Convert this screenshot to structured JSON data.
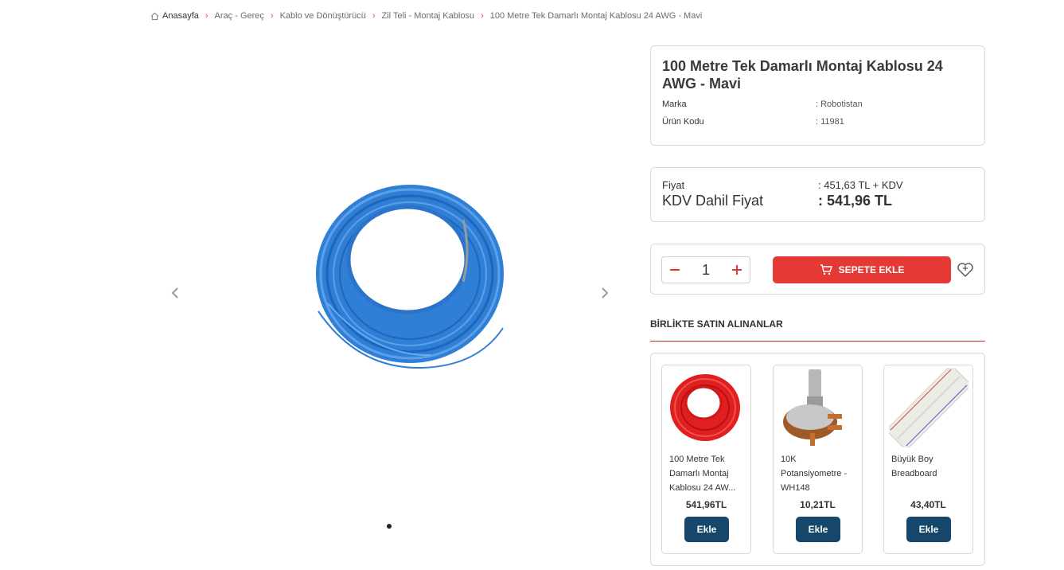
{
  "breadcrumb": {
    "items": [
      "Anasayfa",
      "Araç - Gereç",
      "Kablo ve Dönüştürücü",
      "Zil Teli - Montaj Kablosu",
      "100 Metre Tek Damarlı Montaj Kablosu 24 AWG - Mavi"
    ]
  },
  "product": {
    "title": "100 Metre Tek Damarlı Montaj Kablosu 24 AWG - Mavi",
    "brand_label": "Marka",
    "brand_value": ": Robotistan",
    "code_label": "Ürün Kodu",
    "code_value": ": 11981",
    "image_color": "#2f7fd6"
  },
  "pricing": {
    "price_label": "Fiyat",
    "price_value": ": 451,63 TL + KDV",
    "vat_label": "KDV Dahil Fiyat",
    "vat_value": ": 541,96 TL"
  },
  "cart": {
    "quantity": "1",
    "add_label": "SEPETE EKLE"
  },
  "together": {
    "title": "BİRLİKTE SATIN ALINANLAR",
    "items": [
      {
        "name": "100 Metre Tek Damarlı Montaj Kablosu 24 AW...",
        "price": "541,96TL",
        "button": "Ekle"
      },
      {
        "name": "10K Potansiyometre - WH148",
        "price": "10,21TL",
        "button": "Ekle"
      },
      {
        "name": "Büyük Boy Breadboard",
        "price": "43,40TL",
        "button": "Ekle"
      }
    ]
  },
  "colors": {
    "accent": "#e53935",
    "button_dark": "#16476b"
  }
}
